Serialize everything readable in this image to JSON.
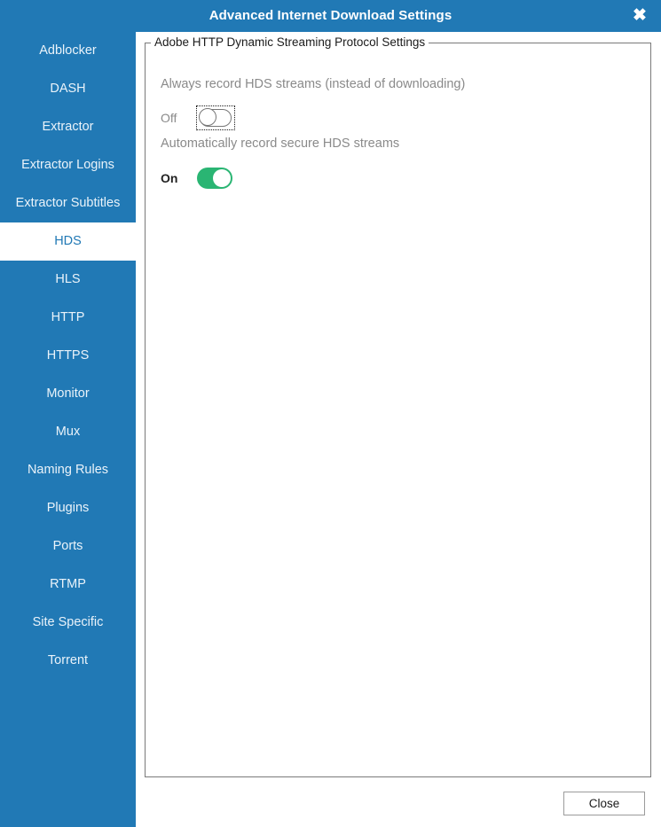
{
  "window": {
    "title": "Advanced Internet Download Settings",
    "close_icon": "close-icon",
    "close_glyph": "✖",
    "titlebar_color": "#2179b5"
  },
  "sidebar": {
    "accent_color": "#2179b5",
    "selected_text_color": "#2179b5",
    "items": [
      {
        "label": "Adblocker",
        "selected": false
      },
      {
        "label": "DASH",
        "selected": false
      },
      {
        "label": "Extractor",
        "selected": false
      },
      {
        "label": "Extractor Logins",
        "selected": false
      },
      {
        "label": "Extractor Subtitles",
        "selected": false
      },
      {
        "label": "HDS",
        "selected": true
      },
      {
        "label": "HLS",
        "selected": false
      },
      {
        "label": "HTTP",
        "selected": false
      },
      {
        "label": "HTTPS",
        "selected": false
      },
      {
        "label": "Monitor",
        "selected": false
      },
      {
        "label": "Mux",
        "selected": false
      },
      {
        "label": "Naming Rules",
        "selected": false
      },
      {
        "label": "Plugins",
        "selected": false
      },
      {
        "label": "Ports",
        "selected": false
      },
      {
        "label": "RTMP",
        "selected": false
      },
      {
        "label": "Site Specific",
        "selected": false
      },
      {
        "label": "Torrent",
        "selected": false
      }
    ]
  },
  "main": {
    "group_title": "Adobe HTTP Dynamic Streaming Protocol Settings",
    "settings": [
      {
        "label": "Always record HDS streams (instead of downloading)",
        "state_label": "Off",
        "state": false,
        "focused": true
      },
      {
        "label": "Automatically record secure HDS streams",
        "state_label": "On",
        "state": true,
        "focused": false
      }
    ],
    "toggle_on_color": "#2ab573"
  },
  "footer": {
    "close_label": "Close"
  }
}
